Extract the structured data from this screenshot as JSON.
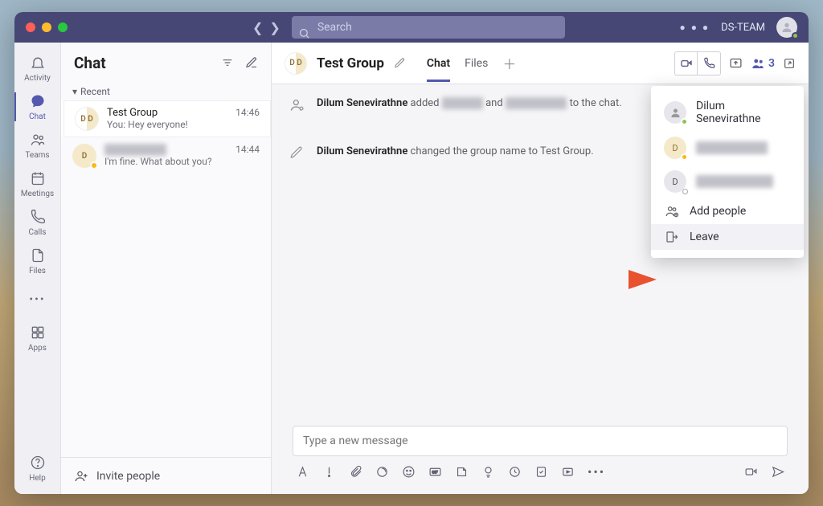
{
  "titlebar": {
    "search_placeholder": "Search",
    "team_name": "DS-TEAM"
  },
  "rail": {
    "activity": "Activity",
    "chat": "Chat",
    "teams": "Teams",
    "meetings": "Meetings",
    "calls": "Calls",
    "files": "Files",
    "apps": "Apps",
    "help": "Help"
  },
  "chat_list": {
    "title": "Chat",
    "recent": "Recent",
    "items": [
      {
        "name": "Test Group",
        "preview": "You: Hey everyone!",
        "time": "14:46",
        "initials": "D D"
      },
      {
        "name": "████ ████",
        "preview": "I'm fine. What about you?",
        "time": "14:44",
        "initials": "D"
      }
    ],
    "invite": "Invite people"
  },
  "main": {
    "group_initials": "D D",
    "group_name": "Test Group",
    "tabs": {
      "chat": "Chat",
      "files": "Files"
    },
    "participants_count": "3",
    "sys_msgs": {
      "added_actor": "Dilum Senevirathne",
      "added_verb": " added ",
      "added_mid": " and ",
      "added_suffix": " to the chat.",
      "renamed_actor": "Dilum Senevirathne",
      "renamed_rest": " changed the group name to Test Group."
    },
    "compose_placeholder": "Type a new message"
  },
  "popover": {
    "members": [
      {
        "name": "Dilum Senevirathne",
        "initials": " ",
        "presence": "online",
        "avtype": "grey"
      },
      {
        "name": "██████ ██",
        "initials": "D",
        "presence": "away",
        "avtype": "y"
      },
      {
        "name": "██████ ████",
        "initials": "D",
        "presence": "offline",
        "avtype": "grey"
      }
    ],
    "add_people": "Add people",
    "leave": "Leave"
  }
}
